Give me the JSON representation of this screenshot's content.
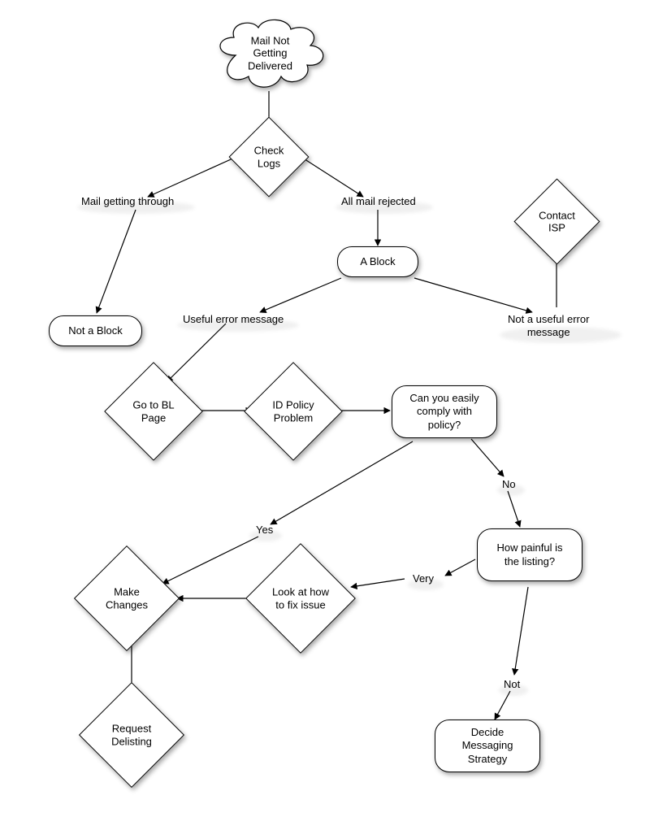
{
  "nodes": {
    "start": "Mail Not\nGetting\nDelivered",
    "checkLogs": "Check\nLogs",
    "notABlock": "Not a Block",
    "aBlock": "A Block",
    "contactISP": "Contact\nISP",
    "goToBL": "Go to BL\nPage",
    "idPolicy": "ID Policy\nProblem",
    "canComply": "Can you easily\ncomply with\npolicy?",
    "howPainful": "How painful is\nthe listing?",
    "makeChanges": "Make\nChanges",
    "lookFix": "Look at how\nto fix issue",
    "requestDelisting": "Request\nDelisting",
    "decideStrategy": "Decide\nMessaging\nStrategy"
  },
  "edges": {
    "mailGettingThrough": "Mail getting through",
    "allMailRejected": "All mail rejected",
    "usefulError": "Useful error message",
    "notUsefulError": "Not a useful error\nmessage",
    "yes": "Yes",
    "no": "No",
    "very": "Very",
    "not": "Not"
  }
}
